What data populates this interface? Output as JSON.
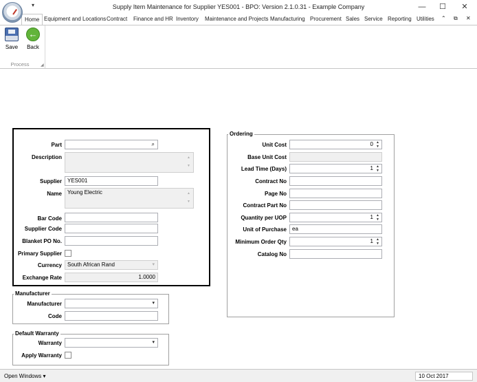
{
  "window": {
    "title": "Supply Item Maintenance for Supplier YES001 - BPO: Version 2.1.0.31 - Example Company",
    "qat_arrow": "▾",
    "minimize": "—",
    "restore": "☐",
    "close": "✕"
  },
  "tabs": [
    "Home",
    "Equipment and Locations",
    "Contract",
    "Finance and HR",
    "Inventory",
    "Maintenance and Projects",
    "Manufacturing",
    "Procurement",
    "Sales",
    "Service",
    "Reporting",
    "Utilities"
  ],
  "tab_extras": {
    "collapse": "⌃",
    "dock": "⧉",
    "close": "✕"
  },
  "ribbon": {
    "save_label": "Save",
    "back_label": "Back",
    "group_label": "Process",
    "launcher": "◢"
  },
  "form": {
    "part": {
      "label": "Part",
      "value": ""
    },
    "description": {
      "label": "Description",
      "value": ""
    },
    "supplier": {
      "label": "Supplier",
      "value": "YES001"
    },
    "name": {
      "label": "Name",
      "value": "Young Electric"
    },
    "bar_code": {
      "label": "Bar Code",
      "value": ""
    },
    "supplier_code": {
      "label": "Supplier Code",
      "value": ""
    },
    "blanket_po": {
      "label": "Blanket PO No.",
      "value": ""
    },
    "primary_supplier": {
      "label": "Primary Supplier",
      "checked": false
    },
    "currency": {
      "label": "Currency",
      "value": "South African Rand"
    },
    "exchange_rate": {
      "label": "Exchange Rate",
      "value": "1.0000"
    }
  },
  "manufacturer": {
    "legend": "Manufacturer",
    "manufacturer": {
      "label": "Manufacturer",
      "value": ""
    },
    "code": {
      "label": "Code",
      "value": ""
    }
  },
  "warranty": {
    "legend": "Default Warranty",
    "warranty": {
      "label": "Warranty",
      "value": ""
    },
    "apply": {
      "label": "Apply Warranty",
      "checked": false
    }
  },
  "ordering": {
    "legend": "Ordering",
    "unit_cost": {
      "label": "Unit Cost",
      "value": "0"
    },
    "base_unit_cost": {
      "label": "Base Unit Cost",
      "value": ""
    },
    "lead_time": {
      "label": "Lead Time (Days)",
      "value": "1"
    },
    "contract_no": {
      "label": "Contract No",
      "value": ""
    },
    "page_no": {
      "label": "Page No",
      "value": ""
    },
    "contract_part_no": {
      "label": "Contract Part No",
      "value": ""
    },
    "qty_per_uop": {
      "label": "Quantity per UOP",
      "value": "1"
    },
    "unit_of_purchase": {
      "label": "Unit of Purchase",
      "value": "ea"
    },
    "min_order_qty": {
      "label": "Minimum Order Qty",
      "value": "1"
    },
    "catalog_no": {
      "label": "Catalog No",
      "value": ""
    }
  },
  "statusbar": {
    "open_windows": "Open Windows ▾",
    "date": "10 Oct 2017"
  }
}
